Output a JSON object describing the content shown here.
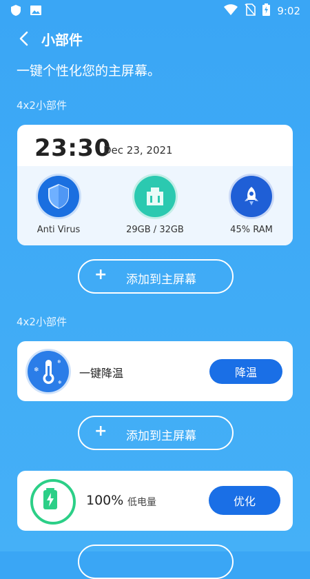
{
  "status_bar": {
    "time": "9:02",
    "left_icons": [
      "shield-icon",
      "image-icon"
    ],
    "right_icons": [
      "wifi-icon",
      "no-sim-icon",
      "battery-charging-icon"
    ]
  },
  "header": {
    "title": "小部件"
  },
  "subtitle": "一键个性化您的主屏幕。",
  "sections": [
    {
      "label": "4x2小部件"
    },
    {
      "label": "4x2小部件"
    }
  ],
  "widget_clock": {
    "time": "23:30",
    "date": "Dec 23, 2021",
    "stats": [
      {
        "label": "Anti Virus",
        "icon": "shield-check-icon"
      },
      {
        "label": "29GB / 32GB",
        "icon": "storage-icon"
      },
      {
        "label": "45% RAM",
        "icon": "rocket-icon"
      }
    ]
  },
  "add_button": {
    "plus": "+",
    "label": "添加到主屏幕"
  },
  "widget_cooling": {
    "name": "一键降温",
    "button": "降温",
    "icon": "thermometer-icon"
  },
  "widget_battery": {
    "percent": "100%",
    "status": "低电量",
    "button": "优化",
    "icon": "battery-icon"
  },
  "colors": {
    "background": "#3aa6f5",
    "accent": "#1a6fe6",
    "battery": "#2ccf87"
  }
}
